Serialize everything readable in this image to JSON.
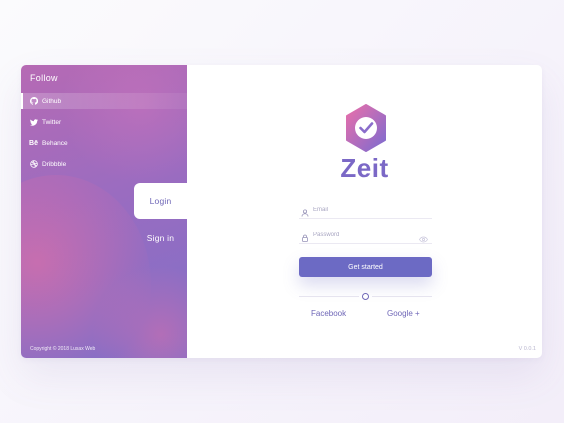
{
  "sidebar": {
    "follow_label": "Follow",
    "links": [
      {
        "label": "Github",
        "icon": "github-icon"
      },
      {
        "label": "Twitter",
        "icon": "twitter-icon"
      },
      {
        "label": "Behance",
        "icon": "behance-icon"
      },
      {
        "label": "Dribbble",
        "icon": "dribbble-icon"
      }
    ],
    "copyright": "Copyright © 2018 Lusax Web"
  },
  "tabs": {
    "login": "Login",
    "signin": "Sign in"
  },
  "brand": {
    "name": "Zeit",
    "logo_icon": "hexagon-check-icon"
  },
  "form": {
    "email_placeholder": "Email",
    "password_placeholder": "Password",
    "submit_label": "Get started"
  },
  "social_login": {
    "facebook": "Facebook",
    "google": "Google +"
  },
  "version": "V 0.0.1",
  "colors": {
    "accent": "#6c6ac4",
    "brand_text": "#7b68c6",
    "sidebar_start": "#b66ab4",
    "sidebar_end": "#7f6fc8"
  }
}
